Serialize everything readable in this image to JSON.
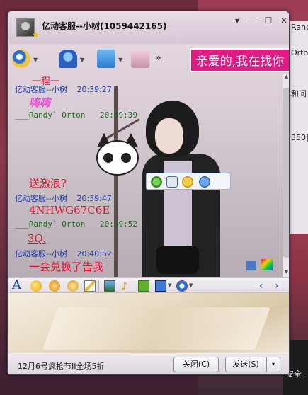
{
  "background": {
    "right_strip_texts": [
      "Rand",
      "Orton",
      "和问",
      "350]"
    ],
    "bottom_strip_text": "安全"
  },
  "window": {
    "title": "亿动客服--小树(1059442165)",
    "buttons": {
      "skin": "▾",
      "minimize": "—",
      "maximize": "☐",
      "close": "✕"
    }
  },
  "toolbar": {
    "more": "»"
  },
  "banner_text": "亲爱的,我在找你",
  "messages": [
    {
      "sender": "亿动客服--小树",
      "time": "20:39:27",
      "text": "嗨嗨",
      "style": "pink"
    },
    {
      "sender": "___Randy` Orton",
      "time": "20:39:39",
      "text": "送激浪?",
      "style": "red-underline"
    },
    {
      "sender": "亿动客服--小树",
      "time": "20:39:47",
      "text": "4NHWG67C6E",
      "style": "red"
    },
    {
      "sender": "___Randy` Orton",
      "time": "20:39:52",
      "text": "3Q.",
      "style": "red-underline"
    },
    {
      "sender": "亿动客服--小树",
      "time": "20:40:52",
      "text": "一会兑换了告我",
      "style": "red"
    }
  ],
  "cut_off_top_text": "一程一",
  "format_toolbar": {
    "font_label": "A",
    "prev": "‹",
    "next": "›"
  },
  "bottom": {
    "promo": "12月6号疯抢节II全场5折",
    "close_btn": "关闭(C)",
    "send_btn": "发送(S)",
    "send_arrow": "▾"
  }
}
